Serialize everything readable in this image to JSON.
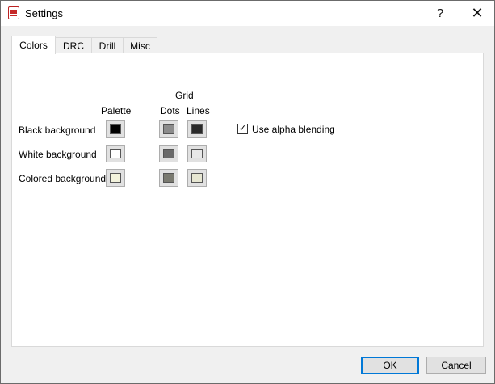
{
  "window": {
    "title": "Settings"
  },
  "titlebar": {
    "help_glyph": "?",
    "close_glyph": "✕"
  },
  "tabs": [
    {
      "label": "Colors",
      "active": true
    },
    {
      "label": "DRC",
      "active": false
    },
    {
      "label": "Drill",
      "active": false
    },
    {
      "label": "Misc",
      "active": false
    }
  ],
  "colors": {
    "headers": {
      "palette": "Palette",
      "grid": "Grid",
      "dots": "Dots",
      "lines": "Lines"
    },
    "rows": [
      {
        "label": "Black background",
        "palette": "#000000",
        "dots": "#8c8c8c",
        "lines": "#2a2a2a"
      },
      {
        "label": "White background",
        "palette": "#ffffff",
        "dots": "#6b6b6b",
        "lines": "#e8e8e8"
      },
      {
        "label": "Colored background",
        "palette": "#f2f2dc",
        "dots": "#7a7a70",
        "lines": "#e6e6d2"
      }
    ],
    "alpha_blending": {
      "label": "Use alpha blending",
      "checked": true,
      "check_glyph": "✓"
    }
  },
  "footer": {
    "ok_label": "OK",
    "cancel_label": "Cancel"
  }
}
